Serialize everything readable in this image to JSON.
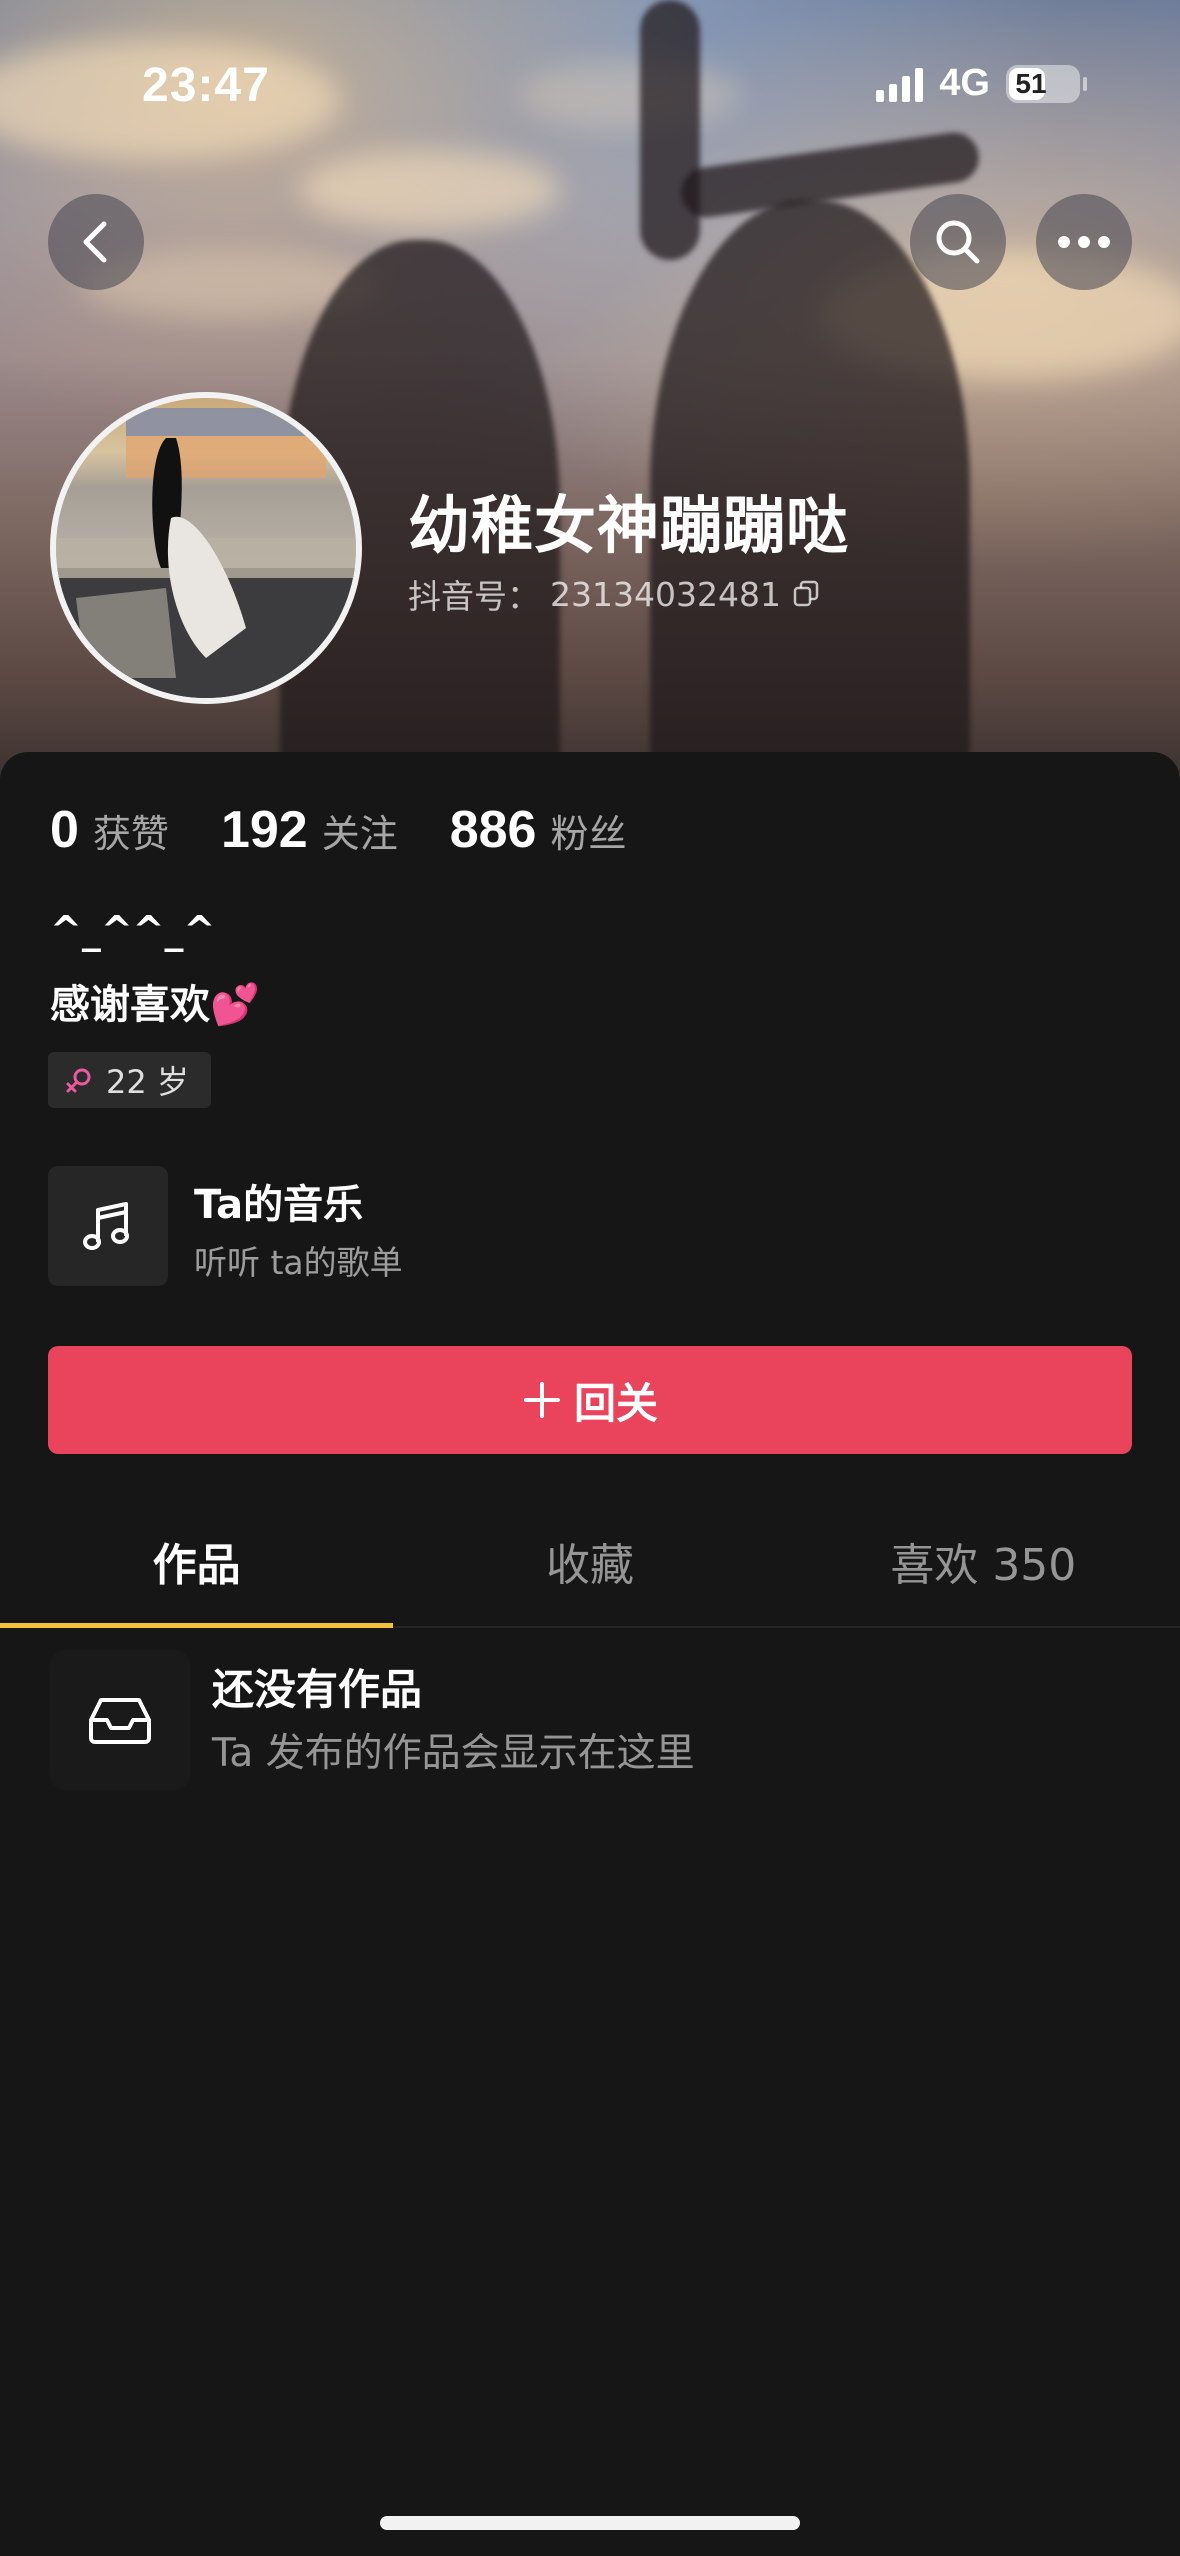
{
  "status_bar": {
    "time": "23:47",
    "network": "4G",
    "battery": "51"
  },
  "header": {
    "back_icon": "chevron-left-icon",
    "search_icon": "search-icon",
    "more_icon": "ellipsis-icon"
  },
  "profile": {
    "nickname": "幼稚女神蹦蹦哒",
    "id_label": "抖音号：",
    "id_value": "23134032481",
    "copy_icon": "copy-icon"
  },
  "stats": [
    {
      "value": "0",
      "label": "获赞"
    },
    {
      "value": "192",
      "label": "关注"
    },
    {
      "value": "886",
      "label": "粉丝"
    }
  ],
  "bio": {
    "line1": "^_^^_^",
    "line2": "感谢喜欢💕"
  },
  "tag": {
    "icon": "female-icon",
    "age": "22 岁",
    "color": "#e85b9c"
  },
  "music": {
    "title": "Ta的音乐",
    "subtitle": "听听 ta的歌单",
    "icon": "music-note-icon"
  },
  "follow_button": {
    "label": "回关",
    "icon": "plus-icon",
    "color": "#ea435c"
  },
  "tabs": [
    {
      "label": "作品",
      "active": true
    },
    {
      "label": "收藏",
      "active": false
    },
    {
      "label": "喜欢 350",
      "active": false
    }
  ],
  "empty_state": {
    "icon": "inbox-icon",
    "title": "还没有作品",
    "subtitle": "Ta 发布的作品会显示在这里"
  },
  "colors": {
    "accent_tab": "#f2c33a",
    "background": "#161616"
  }
}
